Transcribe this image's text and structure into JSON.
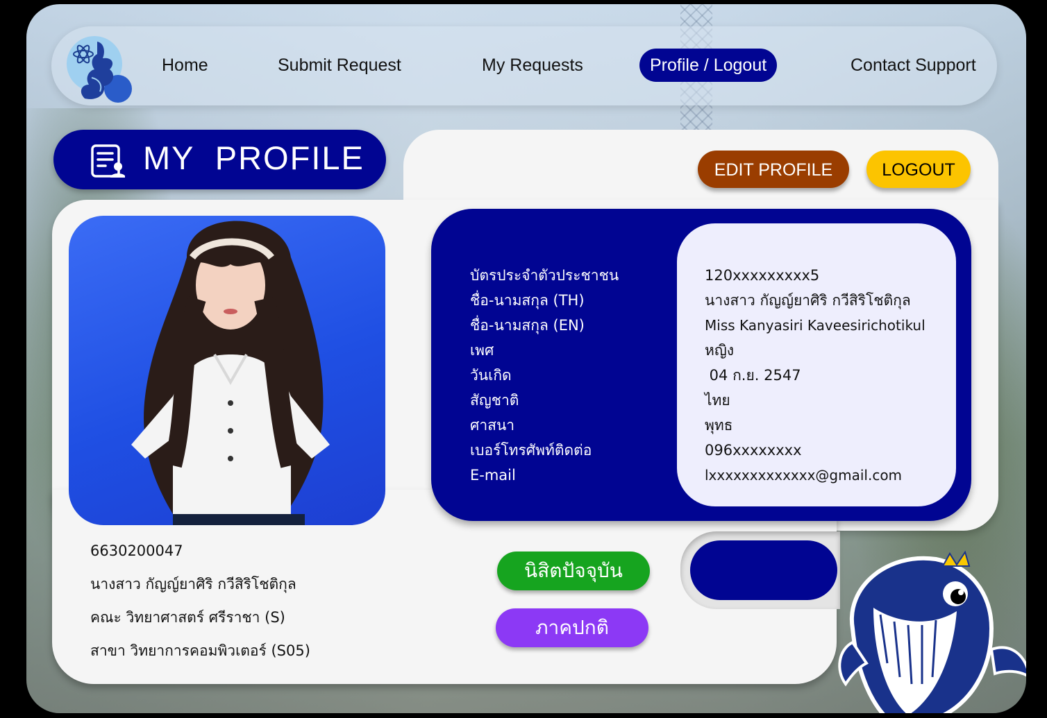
{
  "nav": {
    "items": [
      {
        "label": "Home"
      },
      {
        "label": "Submit Request"
      },
      {
        "label": "My Requests"
      },
      {
        "label": "Profile / Logout",
        "active": true
      },
      {
        "label": "Contact Support"
      }
    ]
  },
  "page": {
    "title": "MY  PROFILE"
  },
  "actions": {
    "edit_label": "EDIT PROFILE",
    "logout_label": "LOGOUT"
  },
  "profile_fields": [
    {
      "label": "บัตรประจำตัวประชาชน",
      "value": "120xxxxxxxxx5"
    },
    {
      "label": "ชื่อ-นามสกุล (TH)",
      "value": "นางสาว กัญญ์ยาศิริ กวีสิริโชติกุล"
    },
    {
      "label": "ชื่อ-นามสกุล (EN)",
      "value": "Miss Kanyasiri Kaveesirichotikul"
    },
    {
      "label": "เพศ",
      "value": "หญิง"
    },
    {
      "label": "วันเกิด",
      "value": " 04 ก.ย. 2547"
    },
    {
      "label": "สัญชาติ",
      "value": "ไทย"
    },
    {
      "label": "ศาสนา",
      "value": "พุทธ"
    },
    {
      "label": "เบอร์โทรศัพท์ติดต่อ",
      "value": "096xxxxxxxx"
    },
    {
      "label": "E-mail",
      "value": "lxxxxxxxxxxxxx@gmail.com"
    }
  ],
  "student": {
    "id": "6630200047",
    "name": "นางสาว กัญญ์ยาศิริ กวีสิริโชติกุล",
    "faculty": "คณะ วิทยาศาสตร์ ศรีราชา (S)",
    "major": "สาขา วิทยาการคอมพิวเตอร์ (S05)"
  },
  "status": {
    "student_status": "นิสิตปัจจุบัน",
    "program": "ภาคปกติ"
  },
  "colors": {
    "primary": "#010592",
    "edit": "#9a3d00",
    "logout": "#fcc400",
    "status_green": "#16a41f",
    "status_purple": "#8c39f5"
  },
  "icons": [
    "logo-icon",
    "profile-card-icon",
    "mascot-icon"
  ]
}
